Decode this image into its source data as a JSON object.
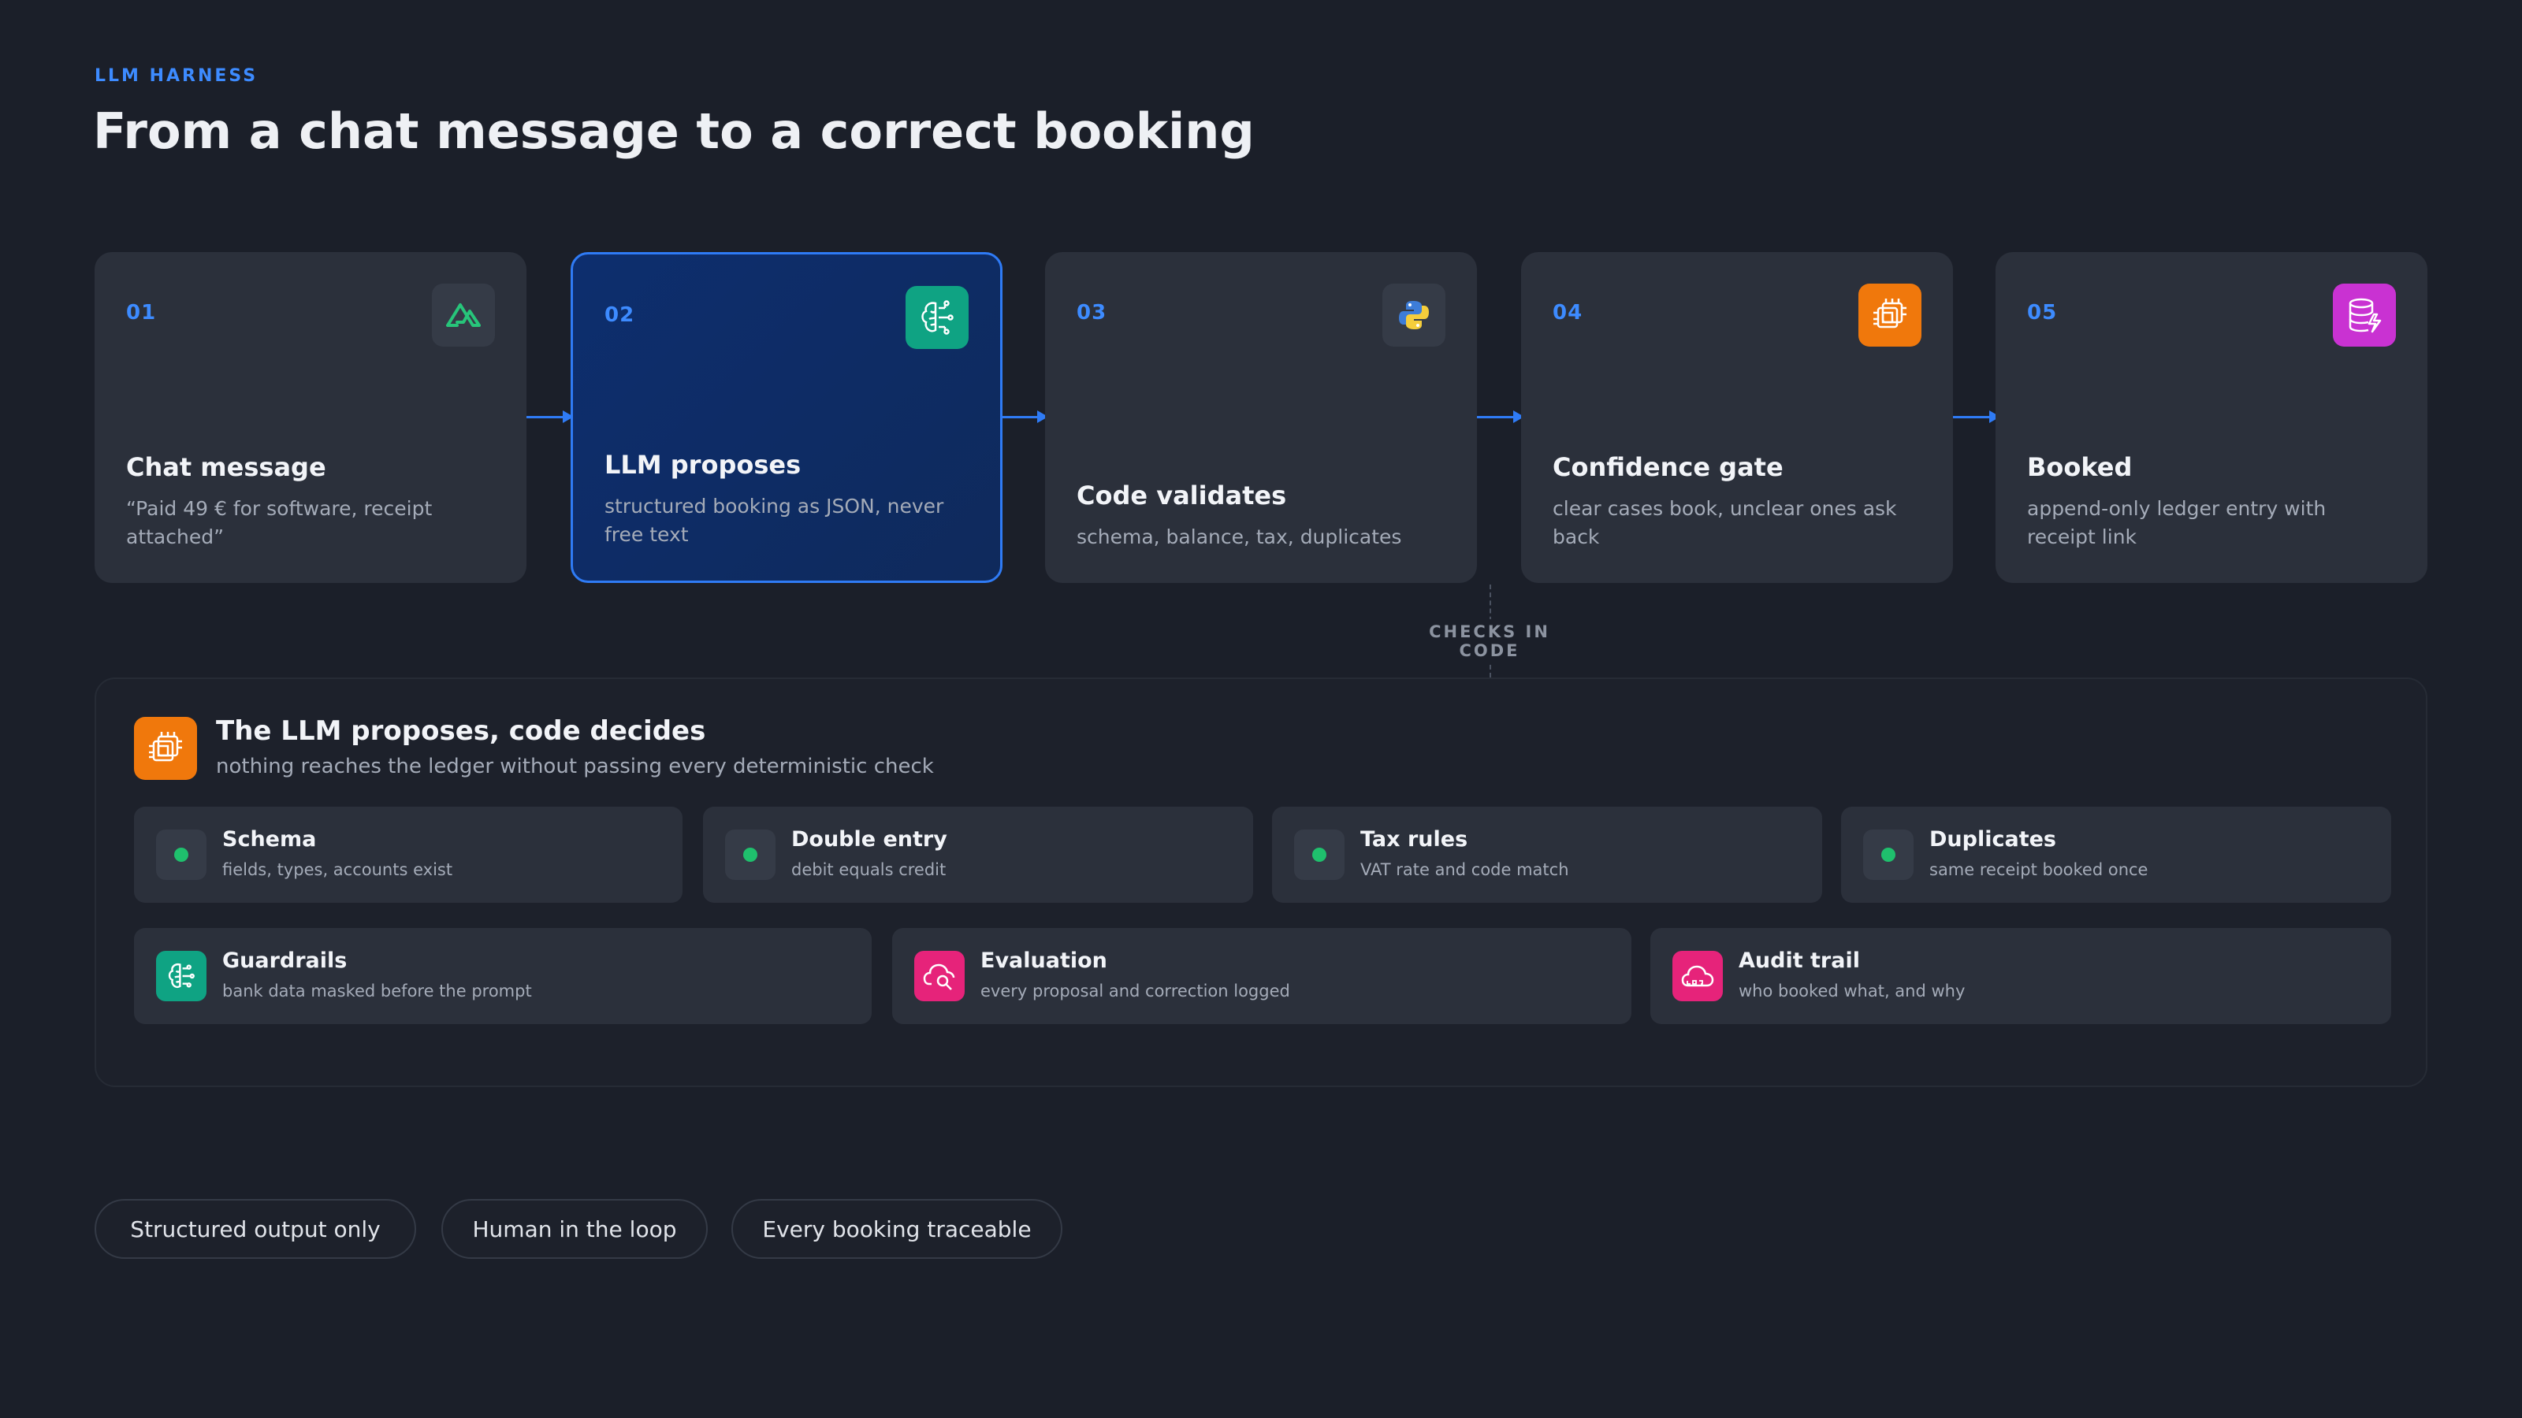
{
  "header": {
    "eyebrow": "LLM HARNESS",
    "title": "From a chat message to a correct booking"
  },
  "steps": [
    {
      "num": "01",
      "title": "Chat message",
      "desc": "“Paid 49 € for software, receipt attached”",
      "icon": "nuxt-icon"
    },
    {
      "num": "02",
      "title": "LLM proposes",
      "desc": "structured booking as JSON, never free text",
      "icon": "brain-circuit-icon"
    },
    {
      "num": "03",
      "title": "Code validates",
      "desc": "schema, balance, tax, duplicates",
      "icon": "python-icon"
    },
    {
      "num": "04",
      "title": "Confidence gate",
      "desc": "clear cases book, unclear ones ask back",
      "icon": "chip-icon"
    },
    {
      "num": "05",
      "title": "Booked",
      "desc": "append-only ledger entry with receipt link",
      "icon": "database-icon"
    }
  ],
  "checks_label": "CHECKS IN CODE",
  "panel": {
    "title": "The LLM proposes, code decides",
    "subtitle": "nothing reaches the ledger without passing every deterministic check",
    "icon": "chip-icon",
    "checks": [
      {
        "title": "Schema",
        "desc": "fields, types, accounts exist",
        "status_color": "#1fc06d"
      },
      {
        "title": "Double entry",
        "desc": "debit equals credit",
        "status_color": "#1fc06d"
      },
      {
        "title": "Tax rules",
        "desc": "VAT rate and code match",
        "status_color": "#1fc06d"
      },
      {
        "title": "Duplicates",
        "desc": "same receipt booked once",
        "status_color": "#1fc06d"
      }
    ],
    "features": [
      {
        "title": "Guardrails",
        "desc": "bank data masked before the prompt",
        "icon": "brain-circuit-icon"
      },
      {
        "title": "Evaluation",
        "desc": "every proposal and correction logged",
        "icon": "cloud-search-icon"
      },
      {
        "title": "Audit trail",
        "desc": "who booked what, and why",
        "icon": "cloud-log-icon"
      }
    ]
  },
  "pills": [
    "Structured output only",
    "Human in the loop",
    "Every booking traceable"
  ],
  "colors": {
    "accent": "#3d8bff",
    "success": "#1fc06d",
    "orange": "#f0780c",
    "teal": "#0fa383",
    "magenta": "#d63ad9",
    "pink": "#e6237a"
  }
}
